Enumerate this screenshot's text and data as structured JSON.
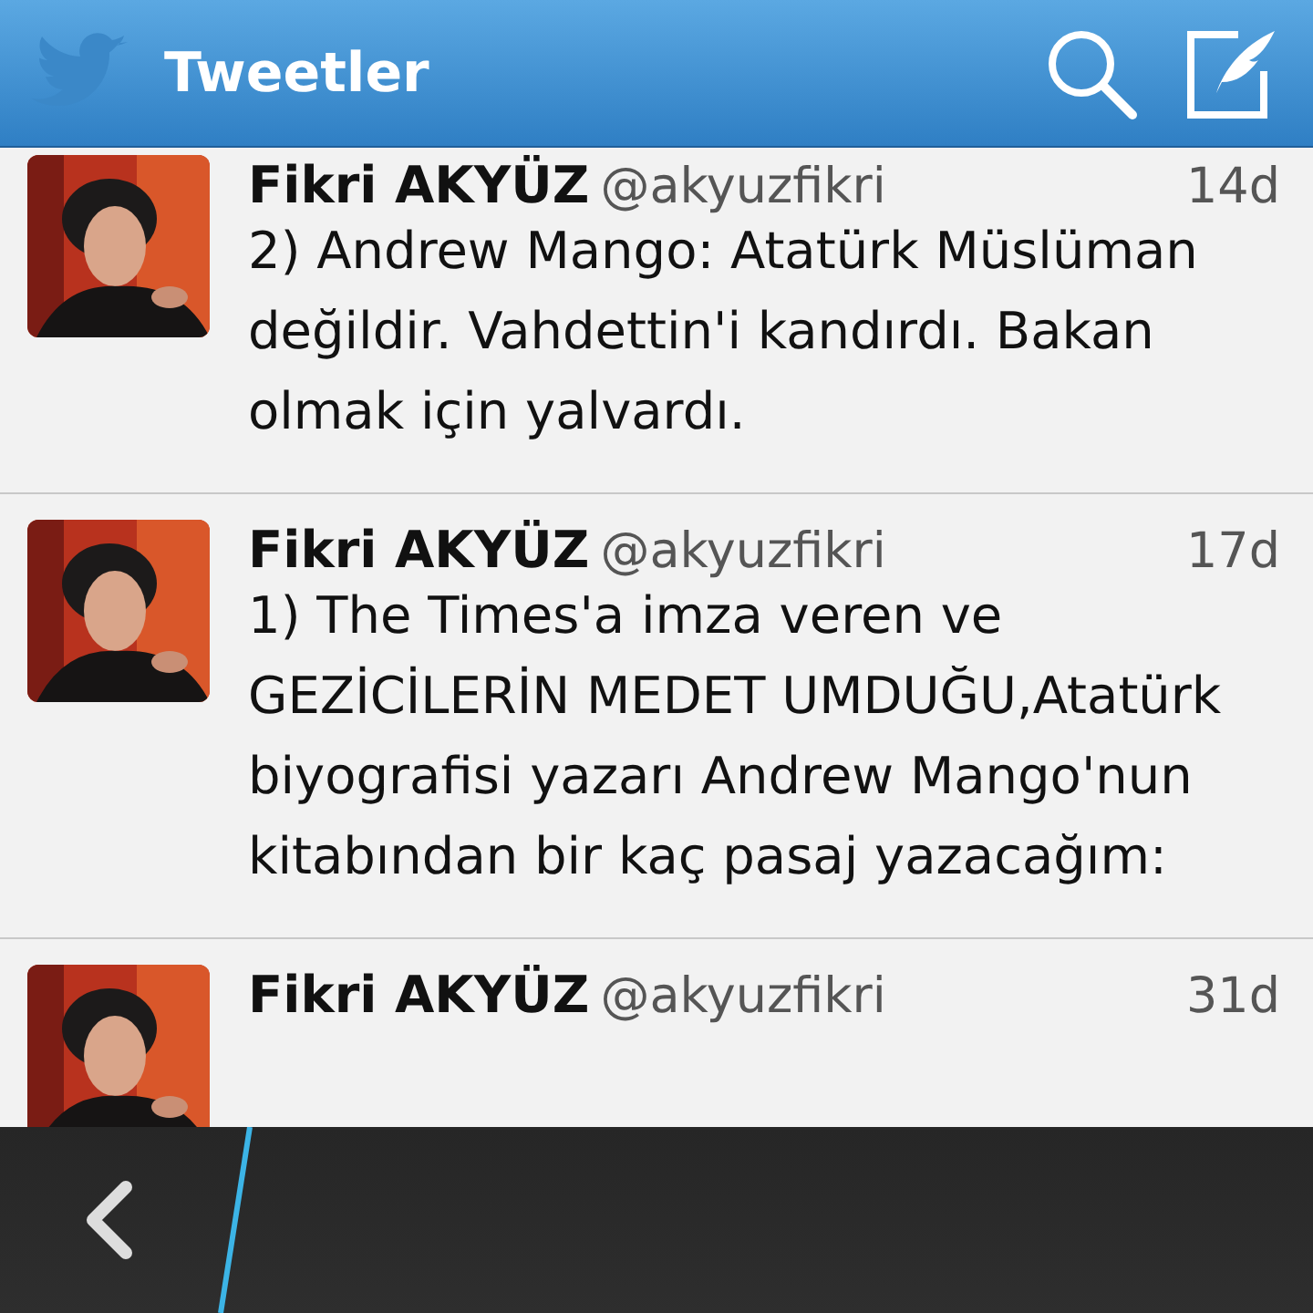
{
  "header": {
    "title": "Tweetler"
  },
  "tweets": [
    {
      "name": "Fikri AKYÜZ",
      "handle": "@akyuzfikri",
      "time": "14d",
      "text": "2) Andrew Mango: Atatürk Müslüman değildir. Vahdettin'i kandırdı. Bakan olmak için yalvardı."
    },
    {
      "name": "Fikri AKYÜZ",
      "handle": "@akyuzfikri",
      "time": "17d",
      "text": "1) The Times'a imza veren ve GEZİCİLERİN MEDET UMDUĞU,Atatürk biyografisi yazarı Andrew Mango'nun kitabından bir kaç pasaj yazacağım:"
    },
    {
      "name": "Fikri AKYÜZ",
      "handle": "@akyuzfikri",
      "time": "31d"
    }
  ]
}
